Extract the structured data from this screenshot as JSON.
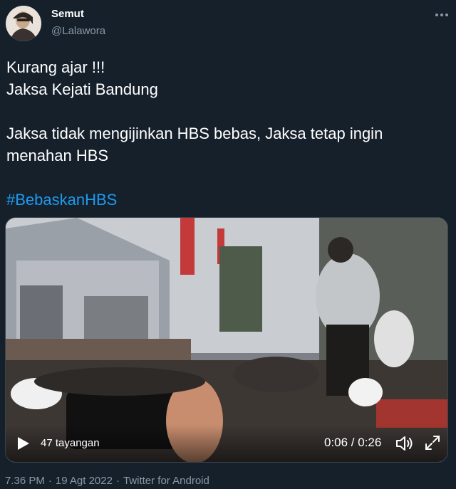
{
  "author": {
    "name": "Semut",
    "handle": "@Lalawora"
  },
  "tweet": {
    "lines": [
      "Kurang ajar !!!",
      "Jaksa Kejati Bandung",
      "",
      "Jaksa tidak mengijinkan HBS bebas, Jaksa tetap ingin",
      "menahan HBS",
      ""
    ],
    "hashtag": "#BebaskanHBS"
  },
  "video": {
    "views": "47 tayangan",
    "time": "0:06 / 0:26"
  },
  "meta": {
    "time": "7.36 PM",
    "sep": "·",
    "date": "19 Agt 2022",
    "source": "Twitter for Android"
  },
  "colors": {
    "background": "#15202b",
    "text": "#ffffff",
    "secondary": "#8b98a5",
    "link": "#1d9bf0"
  },
  "icons": [
    "more-options-icon",
    "play-icon",
    "volume-icon",
    "fullscreen-icon"
  ]
}
